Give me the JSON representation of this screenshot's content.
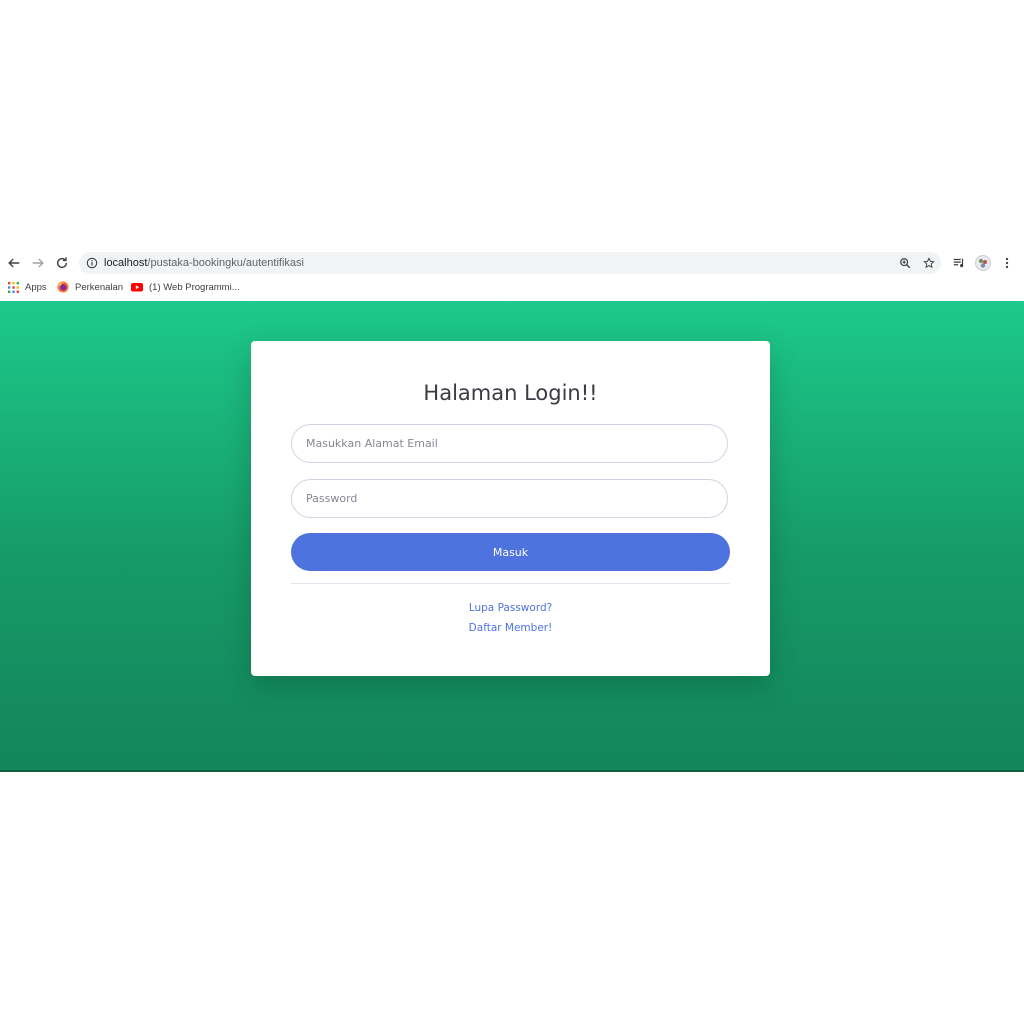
{
  "browser": {
    "url_host": "localhost",
    "url_path": "/pustaka-bookingku/autentifikasi",
    "icons": {
      "back": "arrow-left-icon",
      "forward": "arrow-right-icon",
      "reload": "reload-icon",
      "info": "info-icon",
      "zoom": "zoom-icon",
      "bookmark": "star-icon",
      "media": "media-queue-icon",
      "profile": "profile-avatar-icon",
      "menu": "kebab-menu-icon"
    },
    "bookmarks": [
      {
        "label": "Apps",
        "icon": "apps-grid-icon"
      },
      {
        "label": "Perkenalan",
        "icon": "firefox-icon"
      },
      {
        "label": "(1) Web Programmi...",
        "icon": "youtube-icon"
      }
    ]
  },
  "page": {
    "colors": {
      "gradient_top": "#1dc98b",
      "gradient_bottom": "#13855c",
      "primary": "#4e73df"
    },
    "title": "Halaman Login!!",
    "email_placeholder": "Masukkan Alamat Email",
    "password_placeholder": "Password",
    "submit_label": "Masuk",
    "forgot_link": "Lupa Password?",
    "register_link": "Daftar Member!"
  }
}
